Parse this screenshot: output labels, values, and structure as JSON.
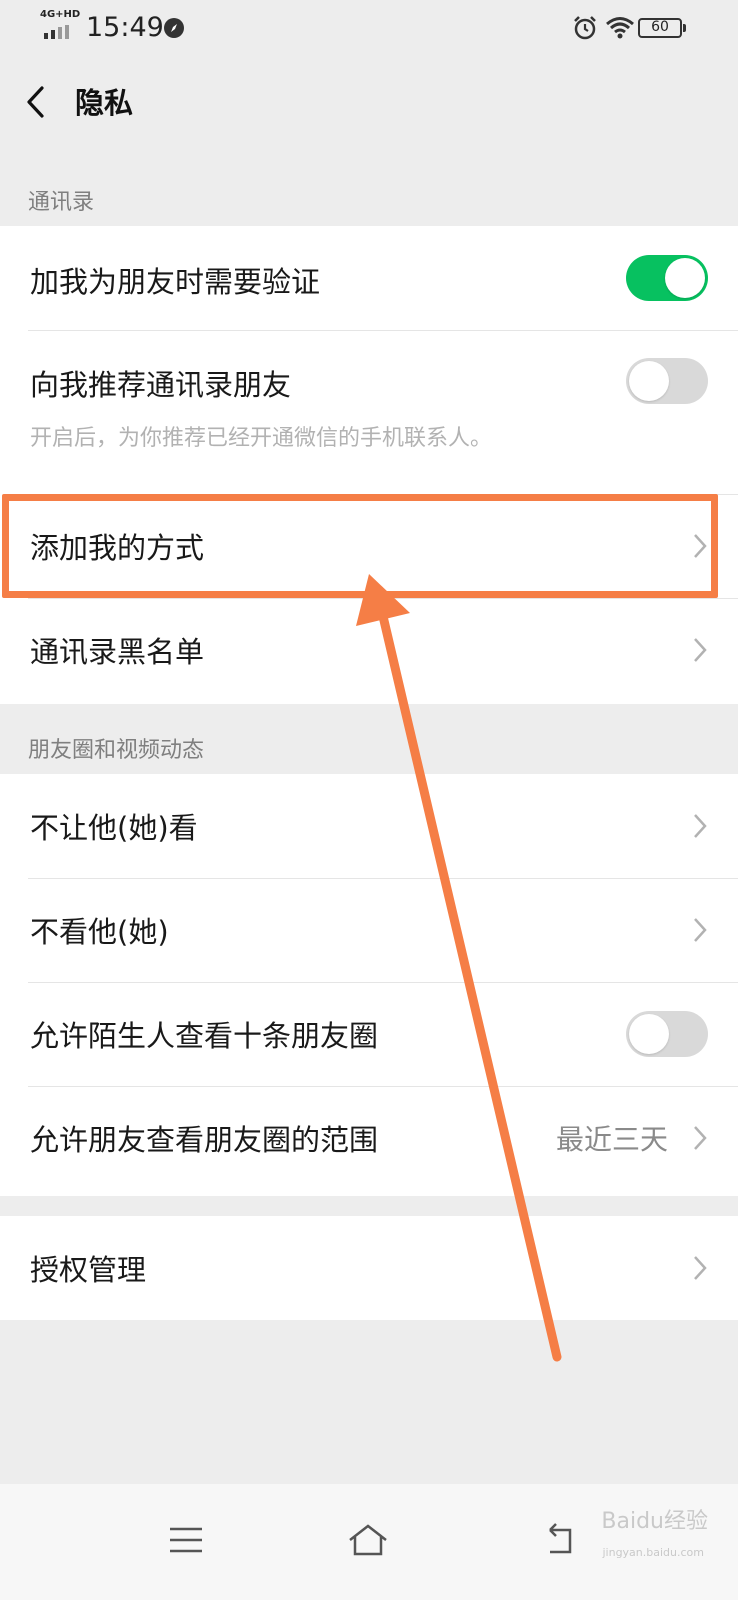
{
  "status_bar": {
    "network": "4G+HD",
    "time": "15:49",
    "battery": "60"
  },
  "nav": {
    "title": "隐私"
  },
  "sections": {
    "contacts": {
      "header": "通讯录",
      "items": [
        {
          "label": "加我为朋友时需要验证",
          "toggle": true
        },
        {
          "label": "向我推荐通讯录朋友",
          "toggle": false,
          "description": "开启后，为你推荐已经开通微信的手机联系人。"
        },
        {
          "label": "添加我的方式"
        },
        {
          "label": "通讯录黑名单"
        }
      ]
    },
    "moments": {
      "header": "朋友圈和视频动态",
      "items": [
        {
          "label": "不让他(她)看"
        },
        {
          "label": "不看他(她)"
        },
        {
          "label": "允许陌生人查看十条朋友圈",
          "toggle": false
        },
        {
          "label": "允许朋友查看朋友圈的范围",
          "value": "最近三天"
        }
      ]
    },
    "auth": {
      "items": [
        {
          "label": "授权管理"
        }
      ]
    }
  },
  "watermark": {
    "text": "Baidu经验",
    "sub": "jingyan.baidu.com"
  },
  "colors": {
    "toggle_on": "#07c160",
    "toggle_off": "#d9d9d9",
    "annotation": "#f57e46",
    "background": "#ededed"
  }
}
